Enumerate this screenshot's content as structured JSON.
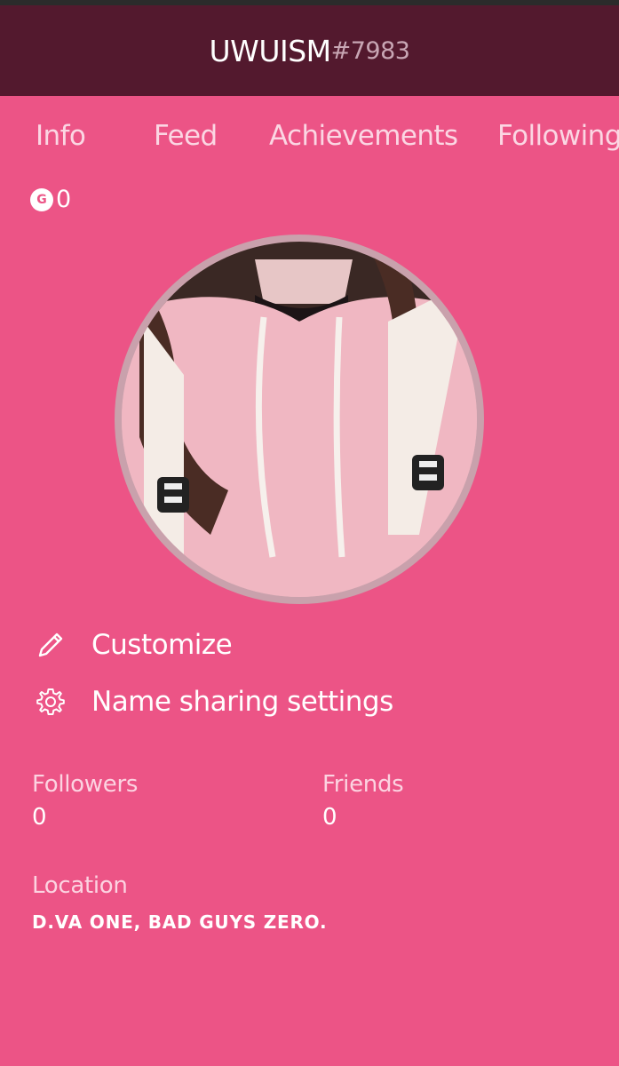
{
  "header": {
    "gamertag": "UWUISM",
    "suffix": "#7983"
  },
  "tabs": [
    {
      "label": "Info"
    },
    {
      "label": "Feed"
    },
    {
      "label": "Achievements"
    },
    {
      "label": "Following"
    }
  ],
  "gamerscore": {
    "icon_letter": "G",
    "value": "0"
  },
  "avatar": {
    "icon": "profile-picture"
  },
  "actions": {
    "customize": {
      "label": "Customize",
      "icon": "pencil-icon"
    },
    "name_sharing": {
      "label": "Name sharing settings",
      "icon": "gear-icon"
    }
  },
  "stats": {
    "followers": {
      "label": "Followers",
      "value": "0"
    },
    "friends": {
      "label": "Friends",
      "value": "0"
    }
  },
  "location": {
    "label": "Location",
    "value": "D.VA ONE, BAD GUYS ZERO."
  },
  "colors": {
    "background": "#ec5486",
    "header": "#53192e",
    "tab_text": "#fbd6e3",
    "muted_label": "#fcd3e1"
  }
}
